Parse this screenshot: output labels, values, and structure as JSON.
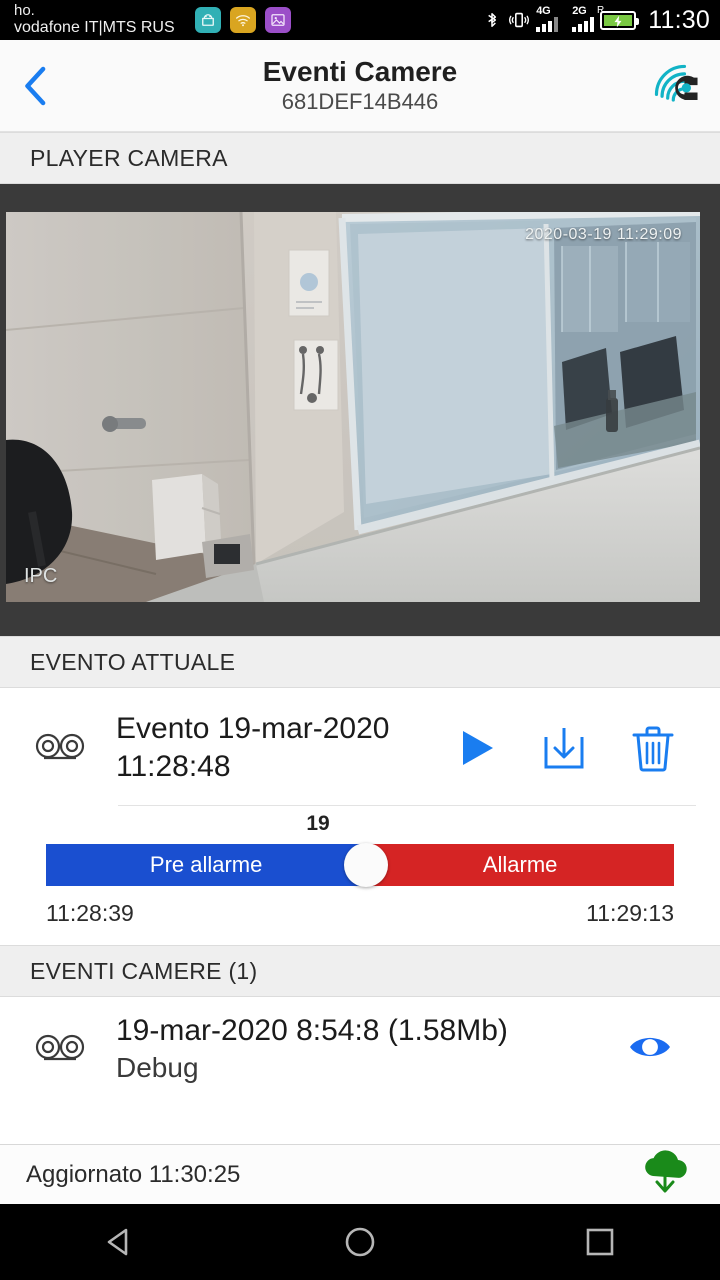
{
  "status_bar": {
    "carrier_line1": "ho.",
    "carrier_line2": "vodafone IT|MTS RUS",
    "clock": "11:30",
    "notif_icons": [
      "android-icon",
      "wifi-icon",
      "photo-icon"
    ],
    "network_1": "4G",
    "network_2": "2G",
    "roaming": "R",
    "icons": [
      "bluetooth-icon",
      "vibrate-icon",
      "signal-icon",
      "battery-charging-icon"
    ]
  },
  "header": {
    "back_icon": "chevron-left-icon",
    "title": "Eventi Camere",
    "subtitle": "681DEF14B446",
    "logo_icon": "app-logo-icon"
  },
  "player_section": {
    "title": "PLAYER CAMERA",
    "video_timestamp": "2020-03-19 11:29:09",
    "video_tag": "IPC"
  },
  "current_event_section": {
    "title": "EVENTO ATTUALE",
    "reel_icon": "tape-reel-icon",
    "event_label": "Evento 19-mar-2020 11:28:48",
    "actions": [
      {
        "name": "play-button",
        "icon": "play-icon"
      },
      {
        "name": "download-button",
        "icon": "download-icon"
      },
      {
        "name": "delete-button",
        "icon": "trash-icon"
      }
    ]
  },
  "timeline": {
    "value_label": "19",
    "pre_alarm_label": "Pre allarme",
    "alarm_label": "Allarme",
    "start_time": "11:28:39",
    "end_time": "11:29:13",
    "thumb_percent": 51,
    "pre_alarm_color": "#1a4fd0",
    "alarm_color": "#d52424"
  },
  "events_section": {
    "title": "EVENTI CAMERE (1)",
    "rows": [
      {
        "reel_icon": "tape-reel-icon",
        "label": "19-mar-2020 8:54:8 (1.58Mb)",
        "sublabel": "Debug",
        "eye_icon": "eye-icon"
      }
    ]
  },
  "footer": {
    "status_text": "Aggiornato 11:30:25",
    "sync_icon": "cloud-download-icon",
    "sync_color": "#1a8a1a"
  },
  "nav_bar": {
    "back": "nav-back-icon",
    "home": "nav-home-icon",
    "recents": "nav-recents-icon"
  }
}
